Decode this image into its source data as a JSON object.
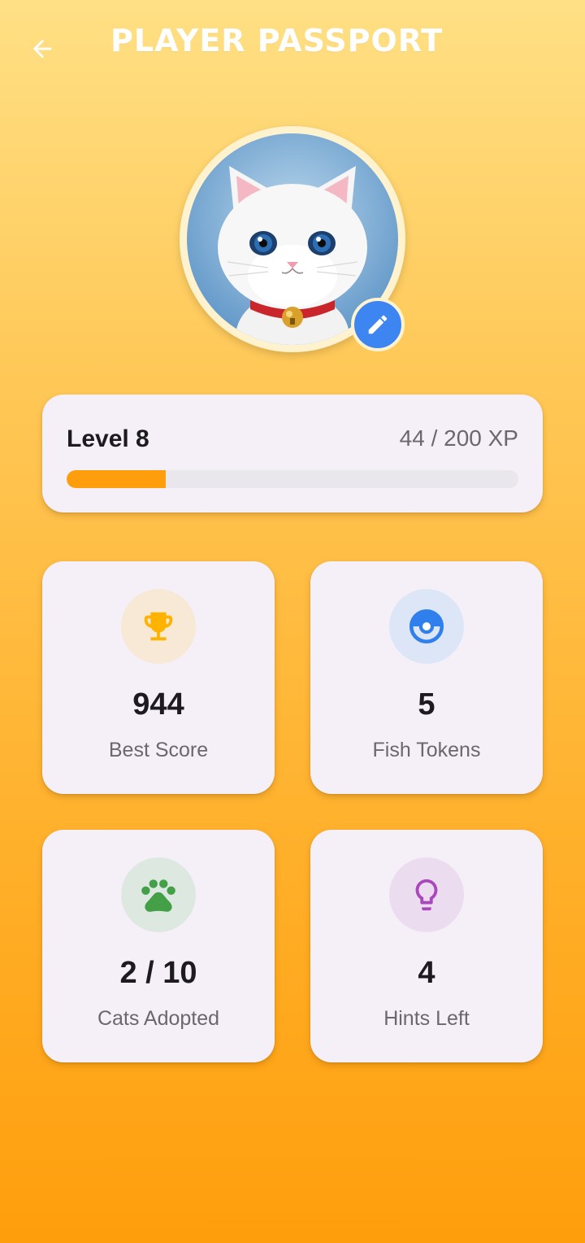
{
  "header": {
    "title": "PLAYER PASSPORT",
    "back_icon": "arrow-left-icon"
  },
  "avatar": {
    "image": "white-cat-avatar",
    "edit_icon": "pencil-icon"
  },
  "level": {
    "label": "Level 8",
    "xp_text": "44 / 200 XP",
    "xp_current": 44,
    "xp_max": 200,
    "progress_fraction": 0.22
  },
  "stats": [
    {
      "value": "944",
      "label": "Best Score",
      "icon": "trophy-icon",
      "icon_color": "#FFB300",
      "bg_color": "#F7E9D5"
    },
    {
      "value": "5",
      "label": "Fish Tokens",
      "icon": "token-icon",
      "icon_color": "#2F80ED",
      "bg_color": "#DCE6F7"
    },
    {
      "value": "2 / 10",
      "label": "Cats Adopted",
      "icon": "paw-icon",
      "icon_color": "#43A047",
      "bg_color": "#DDE9E0"
    },
    {
      "value": "4",
      "label": "Hints Left",
      "icon": "lightbulb-icon",
      "icon_color": "#AB47BC",
      "bg_color": "#EBDDEF"
    }
  ],
  "colors": {
    "accent": "#FF9E0C",
    "card_bg": "#F5F0F8",
    "edit_button": "#3D86F2"
  }
}
